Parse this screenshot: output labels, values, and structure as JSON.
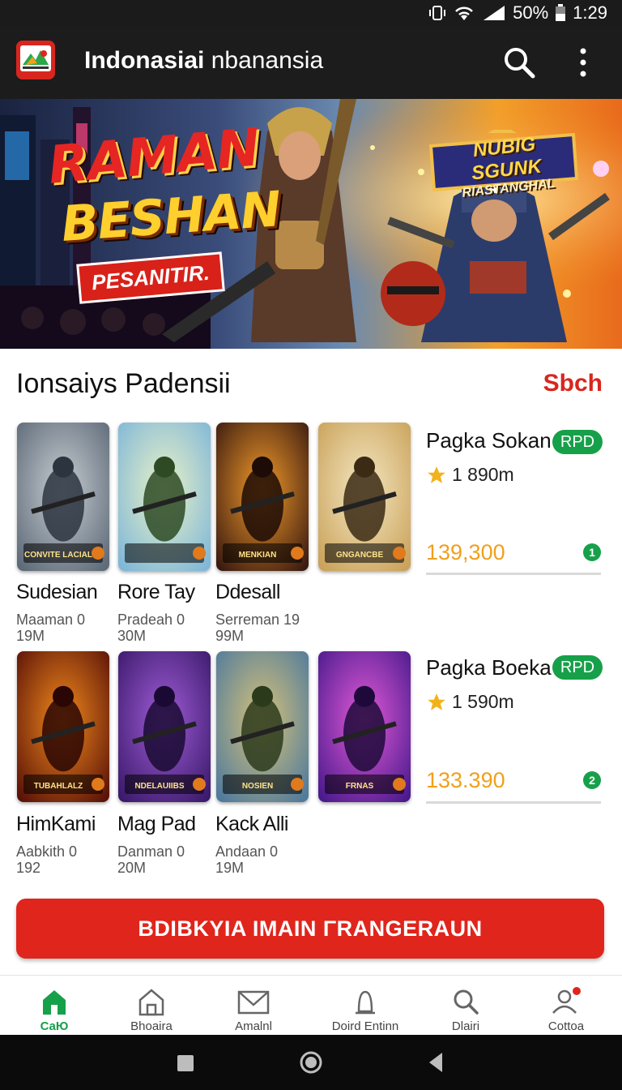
{
  "status_bar": {
    "battery": "50%",
    "time": "1:29"
  },
  "app_bar": {
    "title_bold": "Indonasiai",
    "title_rest": " nbanansia"
  },
  "hero": {
    "title_line1": "RAMAN",
    "title_line2": "BESHAN",
    "tag": "PESANITIR.",
    "badge_line1": "NUBIG SGUNK",
    "badge_line2": "RIASTANGHAL"
  },
  "section": {
    "title": "Ionsaiys Padensii",
    "link": "Sbch"
  },
  "games": [
    {
      "name": "Sudesian",
      "line1": "Maaman 0",
      "line2": "19M",
      "poster_text": "CONVITE LACIAL",
      "colors": [
        "#5d6a78",
        "#c8cdd2",
        "#2c3440"
      ]
    },
    {
      "name": "Rore Tay",
      "line1": "Pradeah 0",
      "line2": "30M",
      "poster_text": "",
      "colors": [
        "#7fb7d8",
        "#e9f1c7",
        "#2d4a24"
      ]
    },
    {
      "name": "Ddesall",
      "line1": "Serreman 19",
      "line2": "99M",
      "poster_text": "MENKIAN",
      "colors": [
        "#3a1a10",
        "#f29a2a",
        "#1c0b06"
      ]
    },
    {
      "name": "",
      "line1": "",
      "line2": "",
      "poster_text": "GNGANCBE",
      "colors": [
        "#caa25a",
        "#f4e7c2",
        "#3b2a14"
      ]
    },
    {
      "name": "HimKami",
      "line1": "Aabkith 0",
      "line2": "192",
      "poster_text": "TUBAHLALZ",
      "colors": [
        "#5a1208",
        "#f28a1c",
        "#2a0604"
      ]
    },
    {
      "name": "Mag Pad",
      "line1": "Danman 0",
      "line2": "20M",
      "poster_text": "NDELAUIIBS",
      "colors": [
        "#3b1a6b",
        "#9f5cd6",
        "#1a0a33"
      ]
    },
    {
      "name": "Kack Alli",
      "line1": "Andaan 0",
      "line2": "19M",
      "poster_text": "NOSIEN",
      "colors": [
        "#4f7a9c",
        "#d6c27a",
        "#2c3a1c"
      ]
    },
    {
      "name": "",
      "line1": "",
      "line2": "",
      "poster_text": "FRNAS",
      "colors": [
        "#4a1a8c",
        "#e25ad8",
        "#1e0a3a"
      ]
    }
  ],
  "side": [
    {
      "title": "Pagka Sokan",
      "badge": "RPD",
      "rating": "1 890m",
      "price": "139,300",
      "dot": "1"
    },
    {
      "title": "Pagka Boeka",
      "badge": "RPD",
      "rating": "1 590m",
      "price": "133.390",
      "dot": "2"
    }
  ],
  "cta": {
    "label": "BDIBKYIA IMAIN ΓRANGERAUN"
  },
  "nav": [
    {
      "label": "CaЮ",
      "icon": "home-icon",
      "active": true
    },
    {
      "label": "Bhoaira",
      "icon": "store-icon",
      "active": false
    },
    {
      "label": "Amalnl",
      "icon": "mail-icon",
      "active": false
    },
    {
      "label": "Doird Entinn",
      "icon": "user-icon",
      "active": false
    },
    {
      "label": "Dlairi",
      "icon": "search-icon",
      "active": false
    },
    {
      "label": "Cottoa",
      "icon": "profile-icon",
      "active": false
    }
  ],
  "colors": {
    "accent": "#d8261e",
    "green": "#17a04a",
    "price": "#f0a01c"
  }
}
